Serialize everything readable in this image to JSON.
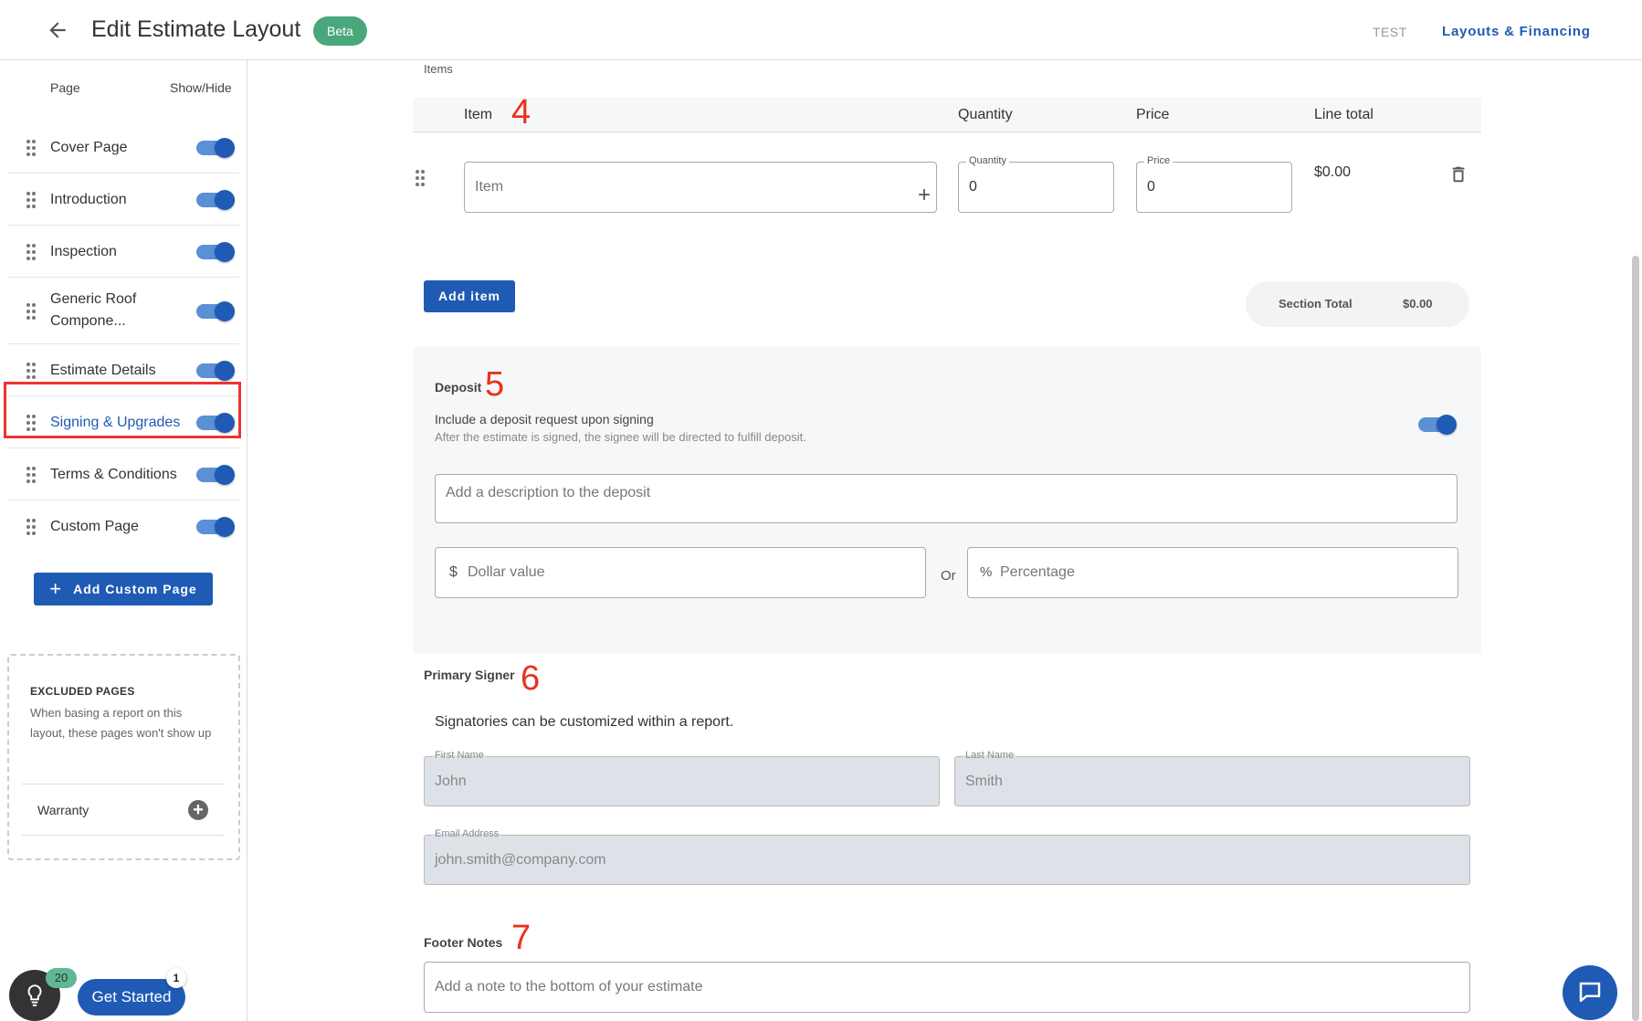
{
  "header": {
    "title": "Edit Estimate Layout",
    "badge": "Beta",
    "test_label": "TEST",
    "layouts_link": "Layouts & Financing"
  },
  "sidebar": {
    "col_page": "Page",
    "col_showhide": "Show/Hide",
    "pages": [
      {
        "label": "Cover Page",
        "visible": true
      },
      {
        "label": "Introduction",
        "visible": true
      },
      {
        "label": "Inspection",
        "visible": true
      },
      {
        "label": "Generic Roof Compone...",
        "visible": true
      },
      {
        "label": "Estimate Details",
        "visible": true
      },
      {
        "label": "Signing & Upgrades",
        "visible": true,
        "selected": true
      },
      {
        "label": "Terms & Conditions",
        "visible": true
      },
      {
        "label": "Custom Page",
        "visible": true
      }
    ],
    "add_custom_page": "Add Custom Page",
    "excluded": {
      "title": "EXCLUDED PAGES",
      "description": "When basing a report on this layout, these pages won't show up",
      "items": [
        {
          "label": "Warranty"
        }
      ]
    }
  },
  "widgets": {
    "tips_count": "20",
    "get_started": "Get Started",
    "get_started_badge": "1"
  },
  "items_section": {
    "label": "Items",
    "marker": "4",
    "columns": {
      "item": "Item",
      "quantity": "Quantity",
      "price": "Price",
      "line_total": "Line total"
    },
    "row": {
      "item_placeholder": "Item",
      "quantity_label": "Quantity",
      "quantity_value": "0",
      "price_label": "Price",
      "price_value": "0",
      "line_total": "$0.00"
    },
    "add_item": "Add item",
    "section_total_label": "Section Total",
    "section_total_value": "$0.00"
  },
  "deposit": {
    "label": "Deposit",
    "marker": "5",
    "toggle_title": "Include a deposit request upon signing",
    "toggle_desc": "After the estimate is signed, the signee will be directed to fulfill deposit.",
    "enabled": true,
    "description_placeholder": "Add a description to the deposit",
    "dollar_placeholder": "Dollar value",
    "or": "Or",
    "percentage_placeholder": "Percentage"
  },
  "primary_signer": {
    "label": "Primary Signer",
    "marker": "6",
    "note": "Signatories can be customized within a report.",
    "first_name_label": "First Name",
    "first_name": "John",
    "last_name_label": "Last Name",
    "last_name": "Smith",
    "email_label": "Email Address",
    "email": "john.smith@company.com"
  },
  "footer_notes": {
    "label": "Footer Notes",
    "marker": "7",
    "placeholder": "Add a note to the bottom of your estimate"
  },
  "colors": {
    "primary": "#1f5bb4",
    "beta_badge": "#4aa77c",
    "highlight": "#ee3333",
    "marker": "#e8321c"
  }
}
